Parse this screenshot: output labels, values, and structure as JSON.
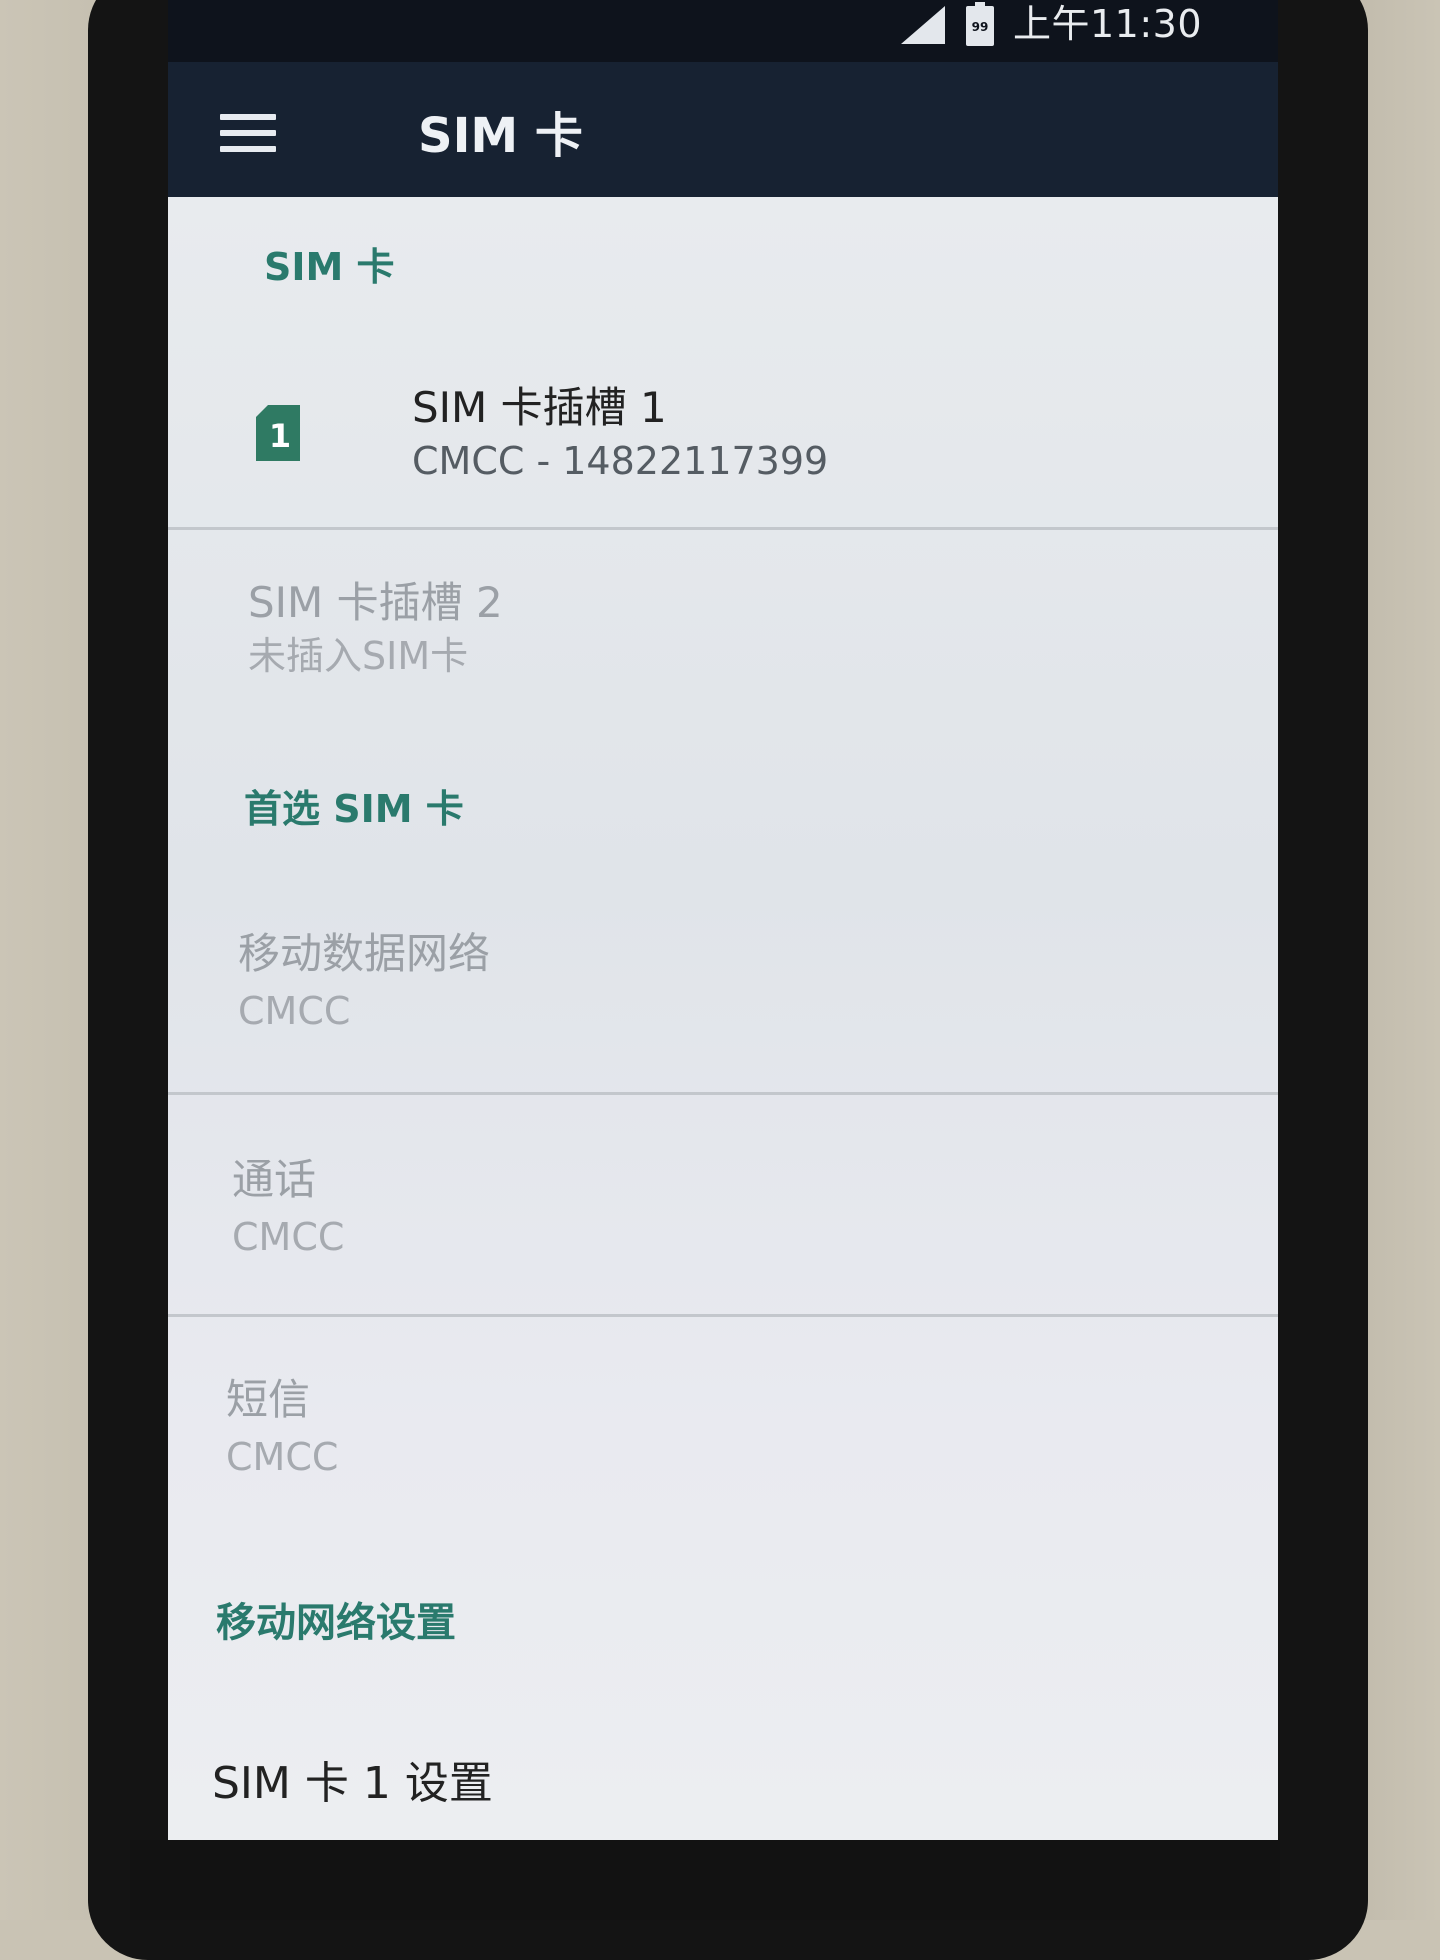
{
  "status_bar": {
    "time": "上午11:30",
    "battery_level": "99",
    "signal_icon": "cellular-signal-icon",
    "battery_icon": "battery-icon"
  },
  "app_bar": {
    "menu_icon": "hamburger-menu-icon",
    "title": "SIM 卡"
  },
  "sections": {
    "sim_cards": {
      "header": "SIM 卡",
      "slot1": {
        "icon_label": "1",
        "title": "SIM 卡插槽 1",
        "summary": "CMCC - 14822117399"
      },
      "slot2": {
        "title": "SIM 卡插槽 2",
        "summary": "未插入SIM卡"
      }
    },
    "preferred": {
      "header": "首选 SIM 卡",
      "mobile_data": {
        "title": "移动数据网络",
        "summary": "CMCC"
      },
      "calls": {
        "title": "通话",
        "summary": "CMCC"
      },
      "sms": {
        "title": "短信",
        "summary": "CMCC"
      }
    },
    "mobile_network": {
      "header": "移动网络设置",
      "sim1_settings": {
        "title": "SIM 卡 1 设置"
      }
    }
  },
  "colors": {
    "accent": "#2a7a6d",
    "app_bar": "#172232",
    "status_bar": "#0e131c",
    "sim_badge": "#2f7a63"
  }
}
